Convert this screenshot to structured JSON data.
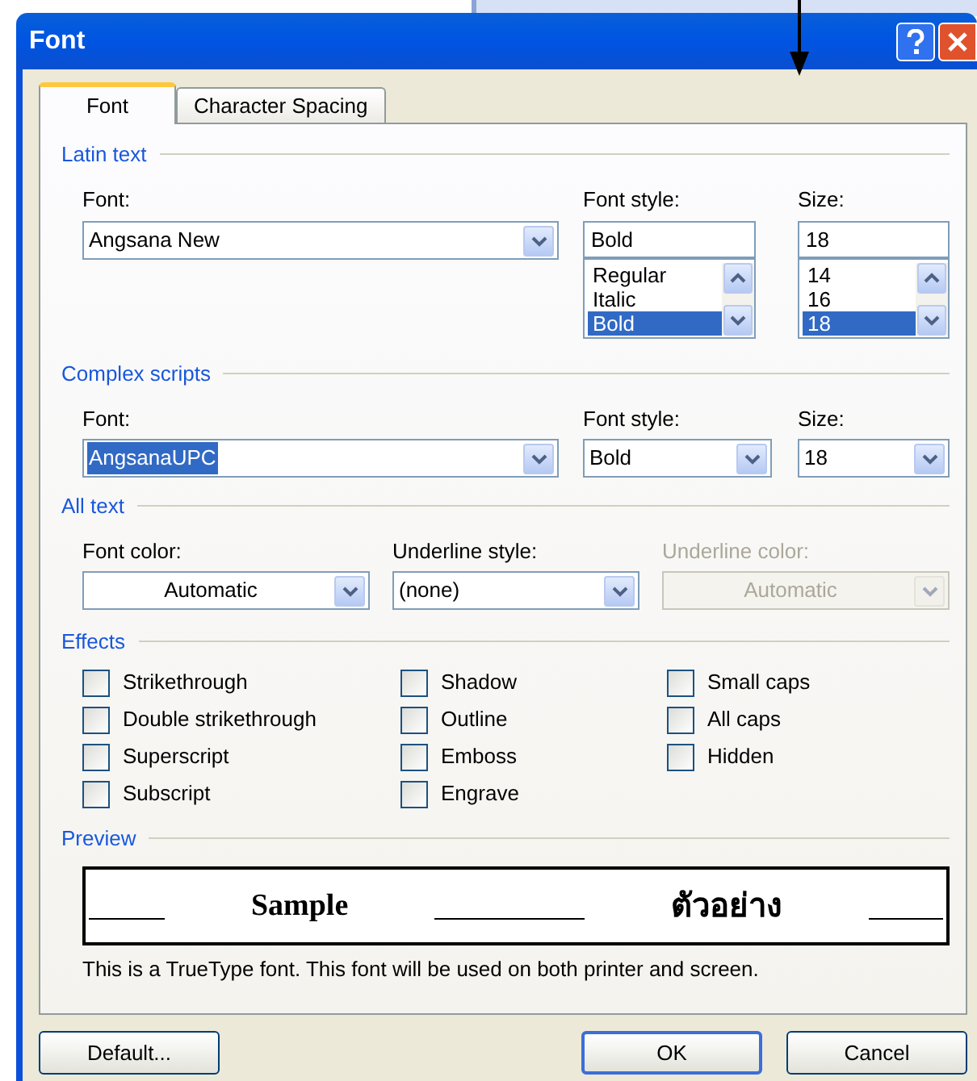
{
  "window": {
    "title": "Font"
  },
  "tabs": [
    {
      "label": "Font",
      "selected": true
    },
    {
      "label": "Character Spacing",
      "selected": false
    }
  ],
  "latin_text": {
    "heading": "Latin text",
    "font": {
      "label": "Font:",
      "value": "Angsana New"
    },
    "font_style": {
      "label": "Font style:",
      "value": "Bold",
      "options": [
        {
          "label": "Regular",
          "selected": false
        },
        {
          "label": "Italic",
          "selected": false
        },
        {
          "label": "Bold",
          "selected": true
        }
      ]
    },
    "size": {
      "label": "Size:",
      "value": "18",
      "options": [
        {
          "label": "14",
          "selected": false
        },
        {
          "label": "16",
          "selected": false
        },
        {
          "label": "18",
          "selected": true
        }
      ]
    }
  },
  "complex_scripts": {
    "heading": "Complex scripts",
    "font": {
      "label": "Font:",
      "value": "AngsanaUPC",
      "highlighted": true
    },
    "font_style": {
      "label": "Font style:",
      "value": "Bold",
      "highlighted": false
    },
    "size": {
      "label": "Size:",
      "value": "18",
      "highlighted": false
    }
  },
  "all_text": {
    "heading": "All text",
    "font_color": {
      "label": "Font color:",
      "value": "Automatic",
      "disabled": false
    },
    "underline_style": {
      "label": "Underline style:",
      "value": "(none)",
      "disabled": false
    },
    "underline_color": {
      "label": "Underline color:",
      "value": "Automatic",
      "disabled": true
    }
  },
  "effects": {
    "heading": "Effects",
    "columns": [
      [
        {
          "label": "Strikethrough",
          "checked": false
        },
        {
          "label": "Double strikethrough",
          "checked": false
        },
        {
          "label": "Superscript",
          "checked": false
        },
        {
          "label": "Subscript",
          "checked": false
        }
      ],
      [
        {
          "label": "Shadow",
          "checked": false
        },
        {
          "label": "Outline",
          "checked": false
        },
        {
          "label": "Emboss",
          "checked": false
        },
        {
          "label": "Engrave",
          "checked": false
        }
      ],
      [
        {
          "label": "Small caps",
          "checked": false
        },
        {
          "label": "All caps",
          "checked": false
        },
        {
          "label": "Hidden",
          "checked": false
        }
      ]
    ]
  },
  "preview": {
    "heading": "Preview",
    "sample_latin": "Sample",
    "sample_complex": "ตัวอย่าง",
    "note": "This is a TrueType font. This font will be used on both printer and screen."
  },
  "buttons": [
    {
      "label": "Default...",
      "default": false
    },
    {
      "label": "OK",
      "default": true
    },
    {
      "label": "Cancel",
      "default": false
    }
  ]
}
